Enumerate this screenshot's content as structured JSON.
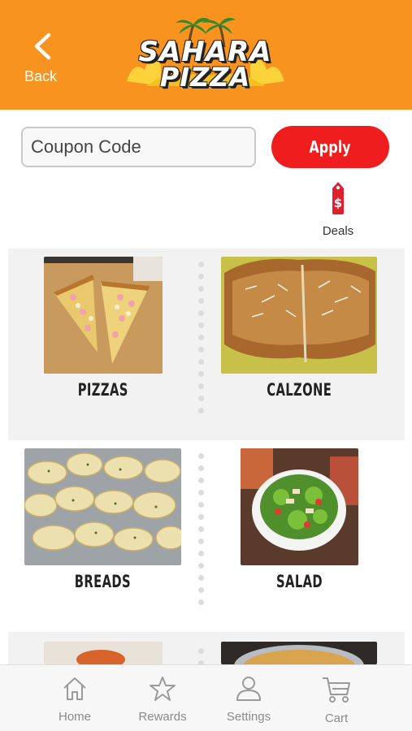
{
  "header": {
    "back_label": "Back",
    "logo_line1": "SAHARA",
    "logo_line2": "PIZZA",
    "background_color": "#f7931e"
  },
  "coupon": {
    "placeholder": "Coupon Code",
    "value": "",
    "apply_label": "Apply",
    "apply_color": "#ef1d1d"
  },
  "deals": {
    "label": "Deals",
    "icon": "price-tag-icon"
  },
  "categories": [
    {
      "label": "PIZZAS",
      "image": "pizza-slices-photo"
    },
    {
      "label": "CALZONE",
      "image": "calzone-photo"
    },
    {
      "label": "BREADS",
      "image": "garlic-knots-photo"
    },
    {
      "label": "SALAD",
      "image": "salad-photo"
    },
    {
      "label": "",
      "image": "wings-photo"
    },
    {
      "label": "",
      "image": "pizza-pan-photo"
    }
  ],
  "tabbar": {
    "items": [
      {
        "label": "Home",
        "icon": "home-icon"
      },
      {
        "label": "Rewards",
        "icon": "star-icon"
      },
      {
        "label": "Settings",
        "icon": "person-icon"
      },
      {
        "label": "Cart",
        "icon": "cart-icon"
      }
    ]
  }
}
